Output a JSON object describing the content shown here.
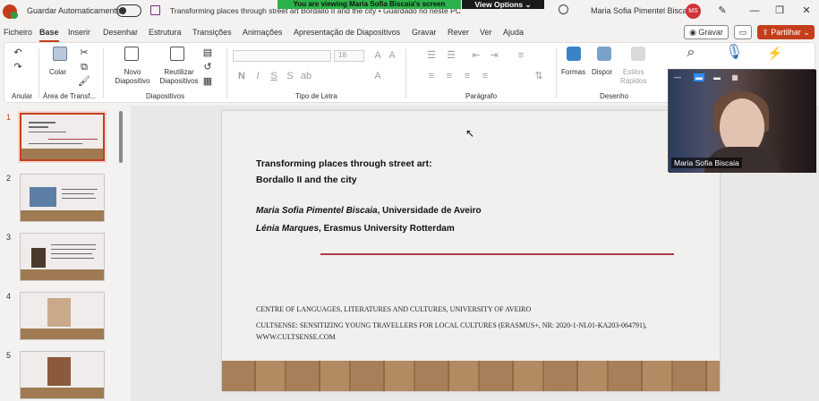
{
  "titlebar": {
    "autosave_label": "Guardar Automaticamente",
    "doc_title": "Transforming places through street art Bordallo II and the city • Guardado no neste PC",
    "share_banner": "You are viewing Maria Sofia Biscaia's screen",
    "view_options": "View Options",
    "user_name": "Maria Sofia Pimentel Biscaia",
    "user_initials": "MS"
  },
  "menu": {
    "tabs": [
      "Ficheiro",
      "Base",
      "Inserir",
      "Desenhar",
      "Estrutura",
      "Transições",
      "Animações",
      "Apresentação de Diapositivos",
      "Gravar",
      "Rever",
      "Ver",
      "Ajuda"
    ],
    "active_tab": "Base",
    "gravar_label": "Gravar",
    "share_label": "Partilhar"
  },
  "ribbon": {
    "groups": [
      "Anular",
      "Área de Transf...",
      "Diapositivos",
      "Tipo de Letra",
      "Parágrafo",
      "Desenho"
    ],
    "colar": "Colar",
    "novo_diapositivo": [
      "Novo",
      "Diapositivo"
    ],
    "reutilizar": [
      "Reutilizar",
      "Diapositivos"
    ],
    "font_size": "18",
    "formas": "Formas",
    "dispor": "Dispor",
    "estilos": [
      "Estilos",
      "Rápidos"
    ]
  },
  "thumbnails": [
    {
      "num": "1",
      "selected": true
    },
    {
      "num": "2",
      "selected": false
    },
    {
      "num": "3",
      "selected": false
    },
    {
      "num": "4",
      "selected": false
    },
    {
      "num": "5",
      "selected": false
    }
  ],
  "slide": {
    "title_line1": "Transforming places through street art:",
    "title_line2": "Bordallo II and the city",
    "author1_name": "Maria Sofia Pimentel Biscaia",
    "author1_affil": ", Universidade de Aveiro",
    "author2_name": "Lénia Marques",
    "author2_affil": ", Erasmus University Rotterdam",
    "centre": "CENTRE OF LANGUAGES, LITERATURES AND CULTURES, UNIVERSITY OF AVEIRO",
    "project_line1": "CULTSENSE: SENSITIZING YOUNG TRAVELLERS FOR LOCAL CULTURES (ERASMUS+, NR: 2020-1-NL01-KA203-064791),",
    "project_line2": "WWW.CULTSENSE.COM"
  },
  "webcam": {
    "participant_name": "Maria Sofia Biscaia"
  },
  "colors": {
    "accent": "#c43e1c",
    "banner": "#2cb24a",
    "slide_rule": "#b03a4a"
  }
}
